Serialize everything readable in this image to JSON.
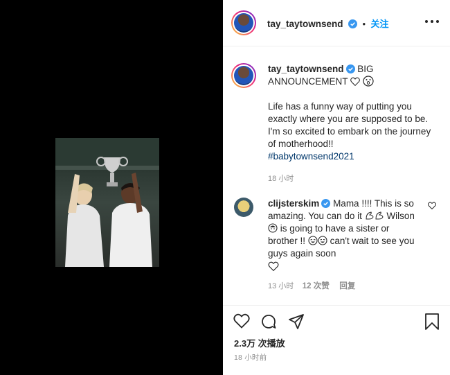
{
  "post": {
    "author": "tay_taytownsend",
    "follow_label": "关注",
    "dot": "•",
    "caption_title": "BIG ANNOUNCEMENT",
    "caption_body": "Life has a funny way of putting you exactly where you are supposed to be. I'm so excited to embark on the journey of motherhood!!",
    "hashtag": "#babytownsend2021",
    "caption_time": "18 小时"
  },
  "comment": {
    "author": "clijsterskim",
    "text_1": "Mama !!!! This is so amazing. You can do it",
    "text_2": "Wilson",
    "text_3": "is going to have a sister or brother !!",
    "text_4": "can't wait to see you guys again soon",
    "time": "13 小时",
    "likes": "12 次赞",
    "reply": "回复"
  },
  "footer": {
    "views": "2.3万 次播放",
    "posted": "18 小时前"
  },
  "colors": {
    "accent": "#0095f6",
    "verified": "#3897f0",
    "muted": "#8e8e8e",
    "hashtag": "#00376b"
  }
}
